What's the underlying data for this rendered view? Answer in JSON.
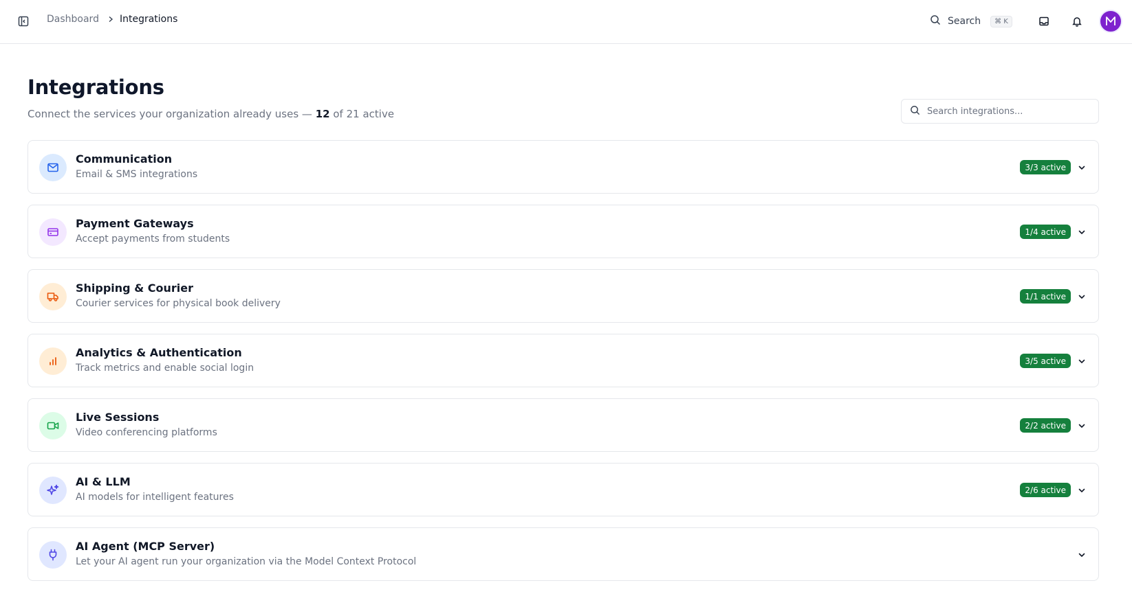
{
  "breadcrumb": {
    "parent": "Dashboard",
    "current": "Integrations"
  },
  "header": {
    "search_label": "Search",
    "search_shortcut": "⌘ K",
    "avatar_initial": "M"
  },
  "page": {
    "title": "Integrations",
    "subtitle_prefix": "Connect the services your organization already uses —",
    "active_count": "12",
    "subtitle_suffix": "of 21 active",
    "search_placeholder": "Search integrations..."
  },
  "colors": {
    "badge_green": "#15803d",
    "avatar_purple": "#7e22ce"
  },
  "categories": [
    {
      "name": "Communication",
      "description": "Email & SMS integrations",
      "badge": "3/3 active",
      "icon": "mail-icon",
      "icon_bg": "#dbeafe",
      "icon_color": "#2563eb"
    },
    {
      "name": "Payment Gateways",
      "description": "Accept payments from students",
      "badge": "1/4 active",
      "icon": "credit-card-icon",
      "icon_bg": "#f3e8ff",
      "icon_color": "#9333ea"
    },
    {
      "name": "Shipping & Courier",
      "description": "Courier services for physical book delivery",
      "badge": "1/1 active",
      "icon": "truck-icon",
      "icon_bg": "#ffedd5",
      "icon_color": "#ea580c"
    },
    {
      "name": "Analytics & Authentication",
      "description": "Track metrics and enable social login",
      "badge": "3/5 active",
      "icon": "bar-chart-icon",
      "icon_bg": "#ffedd5",
      "icon_color": "#ea580c"
    },
    {
      "name": "Live Sessions",
      "description": "Video conferencing platforms",
      "badge": "2/2 active",
      "icon": "video-icon",
      "icon_bg": "#dcfce7",
      "icon_color": "#16a34a"
    },
    {
      "name": "AI & LLM",
      "description": "AI models for intelligent features",
      "badge": "2/6 active",
      "icon": "sparkles-icon",
      "icon_bg": "#e0e7ff",
      "icon_color": "#4f46e5"
    },
    {
      "name": "AI Agent (MCP Server)",
      "description": "Let your AI agent run your organization via the Model Context Protocol",
      "badge": "",
      "icon": "plug-icon",
      "icon_bg": "#e0e7ff",
      "icon_color": "#4f46e5"
    }
  ]
}
